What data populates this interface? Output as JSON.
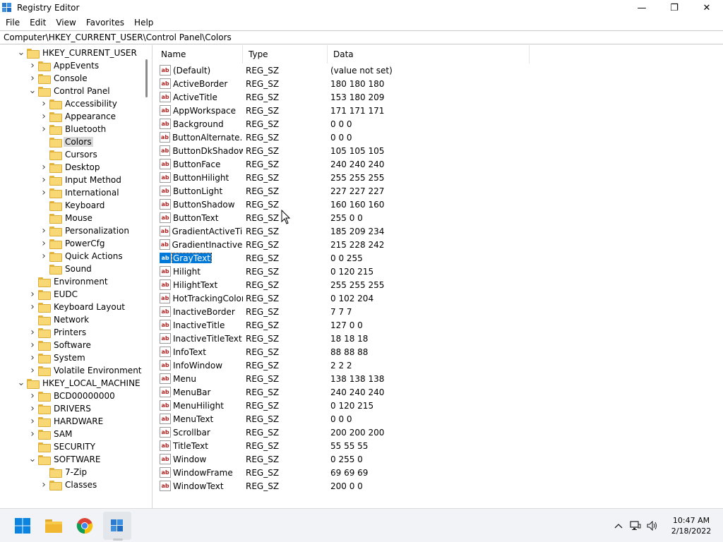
{
  "window": {
    "title": "Registry Editor",
    "minimize_glyph": "—",
    "maximize_glyph": "❐",
    "close_glyph": "✕"
  },
  "menu": [
    "File",
    "Edit",
    "View",
    "Favorites",
    "Help"
  ],
  "address": "Computer\\HKEY_CURRENT_USER\\Control Panel\\Colors",
  "tree": [
    {
      "label": "HKEY_CURRENT_USER",
      "level": 0,
      "state": "expanded"
    },
    {
      "label": "AppEvents",
      "level": 1,
      "state": "collapsed"
    },
    {
      "label": "Console",
      "level": 1,
      "state": "collapsed"
    },
    {
      "label": "Control Panel",
      "level": 1,
      "state": "expanded"
    },
    {
      "label": "Accessibility",
      "level": 2,
      "state": "collapsed"
    },
    {
      "label": "Appearance",
      "level": 2,
      "state": "collapsed"
    },
    {
      "label": "Bluetooth",
      "level": 2,
      "state": "collapsed"
    },
    {
      "label": "Colors",
      "level": 2,
      "state": "leaf",
      "selected": true
    },
    {
      "label": "Cursors",
      "level": 2,
      "state": "leaf"
    },
    {
      "label": "Desktop",
      "level": 2,
      "state": "collapsed"
    },
    {
      "label": "Input Method",
      "level": 2,
      "state": "collapsed"
    },
    {
      "label": "International",
      "level": 2,
      "state": "collapsed"
    },
    {
      "label": "Keyboard",
      "level": 2,
      "state": "leaf"
    },
    {
      "label": "Mouse",
      "level": 2,
      "state": "leaf"
    },
    {
      "label": "Personalization",
      "level": 2,
      "state": "collapsed"
    },
    {
      "label": "PowerCfg",
      "level": 2,
      "state": "collapsed"
    },
    {
      "label": "Quick Actions",
      "level": 2,
      "state": "collapsed"
    },
    {
      "label": "Sound",
      "level": 2,
      "state": "leaf"
    },
    {
      "label": "Environment",
      "level": 1,
      "state": "leaf"
    },
    {
      "label": "EUDC",
      "level": 1,
      "state": "collapsed"
    },
    {
      "label": "Keyboard Layout",
      "level": 1,
      "state": "collapsed"
    },
    {
      "label": "Network",
      "level": 1,
      "state": "leaf"
    },
    {
      "label": "Printers",
      "level": 1,
      "state": "collapsed"
    },
    {
      "label": "Software",
      "level": 1,
      "state": "collapsed"
    },
    {
      "label": "System",
      "level": 1,
      "state": "collapsed"
    },
    {
      "label": "Volatile Environment",
      "level": 1,
      "state": "collapsed"
    },
    {
      "label": "HKEY_LOCAL_MACHINE",
      "level": 0,
      "state": "expanded"
    },
    {
      "label": "BCD00000000",
      "level": 1,
      "state": "collapsed"
    },
    {
      "label": "DRIVERS",
      "level": 1,
      "state": "collapsed"
    },
    {
      "label": "HARDWARE",
      "level": 1,
      "state": "collapsed"
    },
    {
      "label": "SAM",
      "level": 1,
      "state": "collapsed"
    },
    {
      "label": "SECURITY",
      "level": 1,
      "state": "leaf"
    },
    {
      "label": "SOFTWARE",
      "level": 1,
      "state": "expanded"
    },
    {
      "label": "7-Zip",
      "level": 2,
      "state": "leaf"
    },
    {
      "label": "Classes",
      "level": 2,
      "state": "collapsed"
    }
  ],
  "list": {
    "headers": {
      "name": "Name",
      "type": "Type",
      "data": "Data"
    },
    "icon_text": "ab",
    "rows": [
      {
        "name": "(Default)",
        "type": "REG_SZ",
        "data": "(value not set)"
      },
      {
        "name": "ActiveBorder",
        "type": "REG_SZ",
        "data": "180 180 180"
      },
      {
        "name": "ActiveTitle",
        "type": "REG_SZ",
        "data": "153 180 209"
      },
      {
        "name": "AppWorkspace",
        "type": "REG_SZ",
        "data": "171 171 171"
      },
      {
        "name": "Background",
        "type": "REG_SZ",
        "data": "0 0 0"
      },
      {
        "name": "ButtonAlternate...",
        "type": "REG_SZ",
        "data": "0 0 0"
      },
      {
        "name": "ButtonDkShadow",
        "type": "REG_SZ",
        "data": "105 105 105"
      },
      {
        "name": "ButtonFace",
        "type": "REG_SZ",
        "data": "240 240 240"
      },
      {
        "name": "ButtonHilight",
        "type": "REG_SZ",
        "data": "255 255 255"
      },
      {
        "name": "ButtonLight",
        "type": "REG_SZ",
        "data": "227 227 227"
      },
      {
        "name": "ButtonShadow",
        "type": "REG_SZ",
        "data": "160 160 160"
      },
      {
        "name": "ButtonText",
        "type": "REG_SZ",
        "data": "255 0 0"
      },
      {
        "name": "GradientActiveTi...",
        "type": "REG_SZ",
        "data": "185 209 234"
      },
      {
        "name": "GradientInactive...",
        "type": "REG_SZ",
        "data": "215 228 242"
      },
      {
        "name": "GrayText",
        "type": "REG_SZ",
        "data": "0 0 255",
        "selected": true
      },
      {
        "name": "Hilight",
        "type": "REG_SZ",
        "data": "0 120 215"
      },
      {
        "name": "HilightText",
        "type": "REG_SZ",
        "data": "255 255 255"
      },
      {
        "name": "HotTrackingColor",
        "type": "REG_SZ",
        "data": "0 102 204"
      },
      {
        "name": "InactiveBorder",
        "type": "REG_SZ",
        "data": "7 7 7"
      },
      {
        "name": "InactiveTitle",
        "type": "REG_SZ",
        "data": "127 0 0"
      },
      {
        "name": "InactiveTitleText",
        "type": "REG_SZ",
        "data": "18 18 18"
      },
      {
        "name": "InfoText",
        "type": "REG_SZ",
        "data": "88 88 88"
      },
      {
        "name": "InfoWindow",
        "type": "REG_SZ",
        "data": "2 2 2"
      },
      {
        "name": "Menu",
        "type": "REG_SZ",
        "data": "138 138 138"
      },
      {
        "name": "MenuBar",
        "type": "REG_SZ",
        "data": "240 240 240"
      },
      {
        "name": "MenuHilight",
        "type": "REG_SZ",
        "data": "0 120 215"
      },
      {
        "name": "MenuText",
        "type": "REG_SZ",
        "data": "0 0 0"
      },
      {
        "name": "Scrollbar",
        "type": "REG_SZ",
        "data": "200 200 200"
      },
      {
        "name": "TitleText",
        "type": "REG_SZ",
        "data": "55 55 55"
      },
      {
        "name": "Window",
        "type": "REG_SZ",
        "data": "0 255 0"
      },
      {
        "name": "WindowFrame",
        "type": "REG_SZ",
        "data": "69 69 69"
      },
      {
        "name": "WindowText",
        "type": "REG_SZ",
        "data": "200 0 0"
      }
    ]
  },
  "taskbar": {
    "apps": [
      "start-button",
      "file-explorer",
      "chrome",
      "registry-editor"
    ],
    "tray_icons": [
      "chevron-up-icon",
      "network-icon",
      "volume-icon"
    ],
    "time": "10:47 AM",
    "date": "2/18/2022"
  },
  "colors": {
    "selection": "#0078d7",
    "tree_selected": "#d9d9d9",
    "taskbar": "#f1f3f6"
  }
}
